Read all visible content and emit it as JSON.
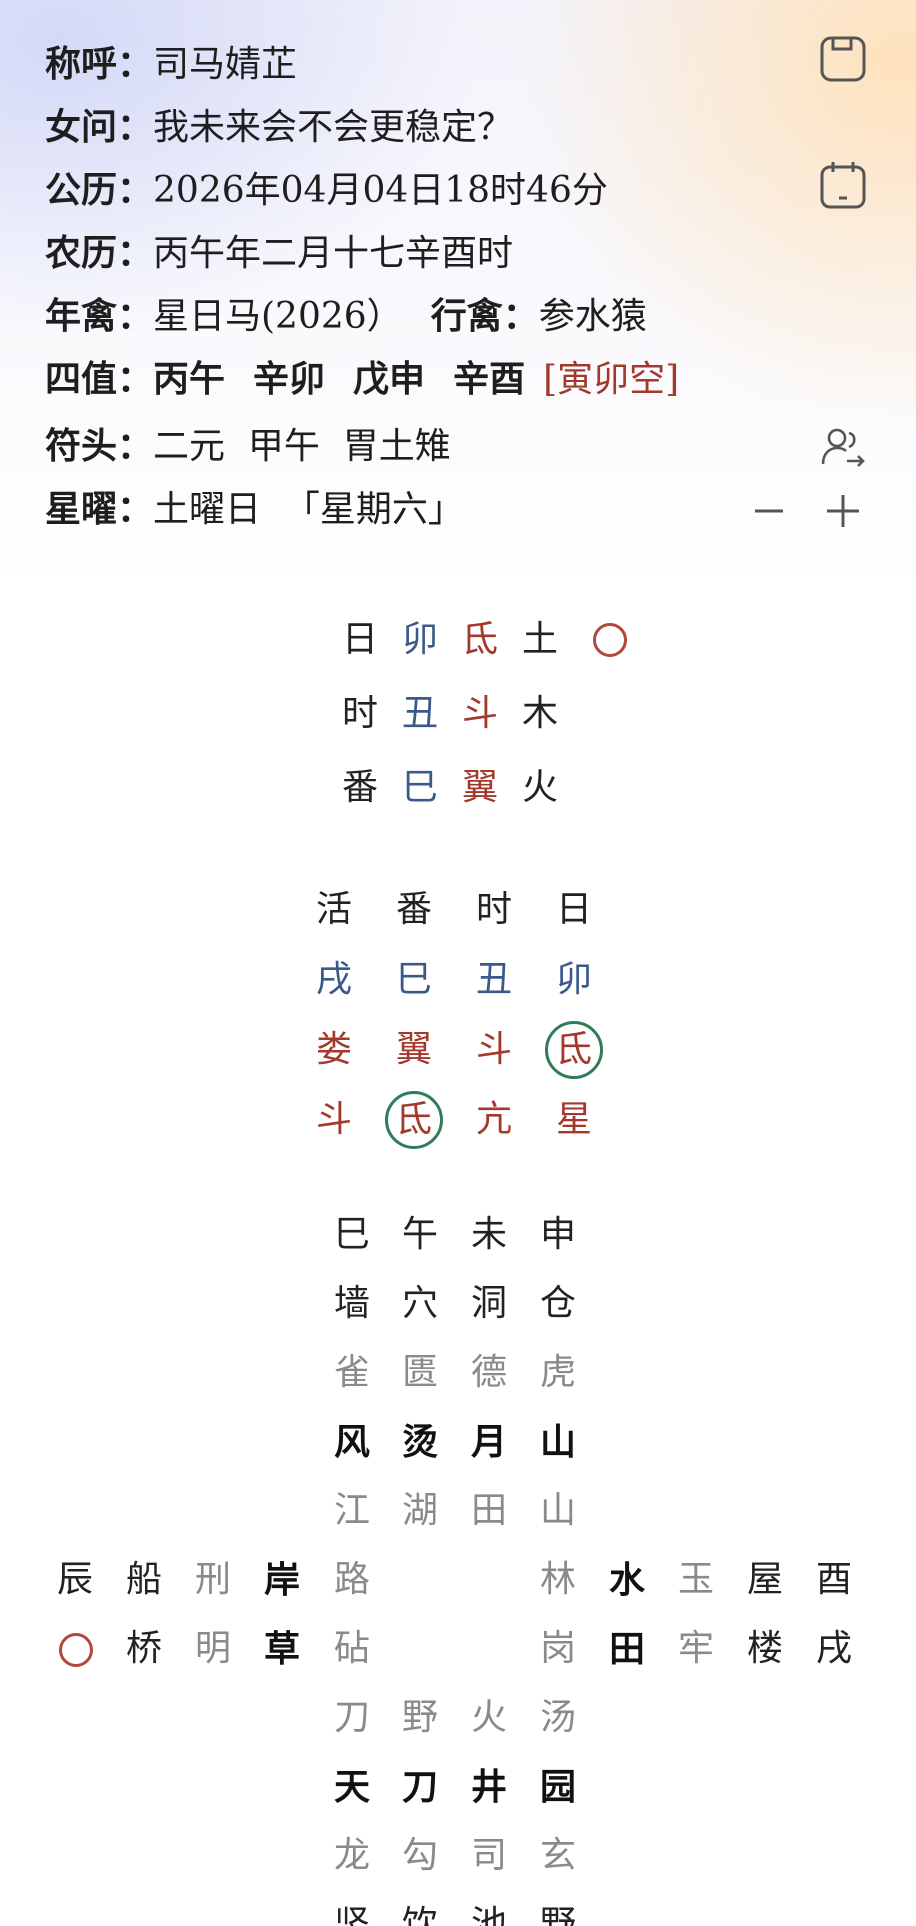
{
  "header": {
    "rows": [
      {
        "label": "称呼：",
        "value": "司马婧芷"
      },
      {
        "label": "女问：",
        "value": "我未来会不会更稳定？"
      },
      {
        "label": "公历：",
        "value": "2026年04月04日18时46分"
      },
      {
        "label": "农历：",
        "value": "丙午年二月十七辛酉时"
      },
      {
        "label": "年禽：",
        "value": "星日马(2026）",
        "label2": "行禽：",
        "value2": "参水猿"
      },
      {
        "label": "四值：",
        "pillars": [
          "丙午",
          "辛卯",
          "戊申",
          "辛酉"
        ],
        "kong": "[寅卯空]"
      },
      {
        "label": "符头：",
        "value": "二元  甲午  胃土雉"
      },
      {
        "label": "星曜：",
        "value": "土曜日  「星期六」"
      }
    ]
  },
  "icons": {
    "save": "save-icon",
    "calendar": "calendar-icon",
    "user_switch": "user-switch-icon",
    "zoom_out": "minus-icon",
    "zoom_in": "plus-icon"
  },
  "block1": [
    [
      "日",
      "卯",
      "氐",
      "土"
    ],
    [
      "时",
      "丑",
      "斗",
      "木"
    ],
    [
      "番",
      "巳",
      "翼",
      "火"
    ]
  ],
  "block2": {
    "header": [
      "活",
      "番",
      "时",
      "日"
    ],
    "branches": [
      "戌",
      "巳",
      "丑",
      "卯"
    ],
    "row3": [
      "娄",
      "翼",
      "斗",
      "氐"
    ],
    "row4": [
      "斗",
      "氐",
      "亢",
      "星"
    ]
  },
  "board": {
    "top": [
      [
        "巳",
        "午",
        "未",
        "申"
      ],
      [
        "墙",
        "穴",
        "洞",
        "仓"
      ],
      [
        "雀",
        "匮",
        "德",
        "虎"
      ],
      [
        "风",
        "烫",
        "月",
        "山"
      ],
      [
        "江",
        "湖",
        "田",
        "山"
      ]
    ],
    "middle_left": [
      [
        "辰",
        "船",
        "刑",
        "岸",
        "路"
      ],
      [
        "",
        "桥",
        "明",
        "草",
        "砧"
      ]
    ],
    "middle_right": [
      [
        "林",
        "水",
        "玉",
        "屋",
        "酉"
      ],
      [
        "岗",
        "田",
        "牢",
        "楼",
        "戌"
      ]
    ],
    "bottom": [
      [
        "刀",
        "野",
        "火",
        "汤"
      ],
      [
        "天",
        "刀",
        "井",
        "园"
      ],
      [
        "龙",
        "勾",
        "司",
        "玄"
      ],
      [
        "竖",
        "饮",
        "池",
        "野"
      ]
    ]
  }
}
